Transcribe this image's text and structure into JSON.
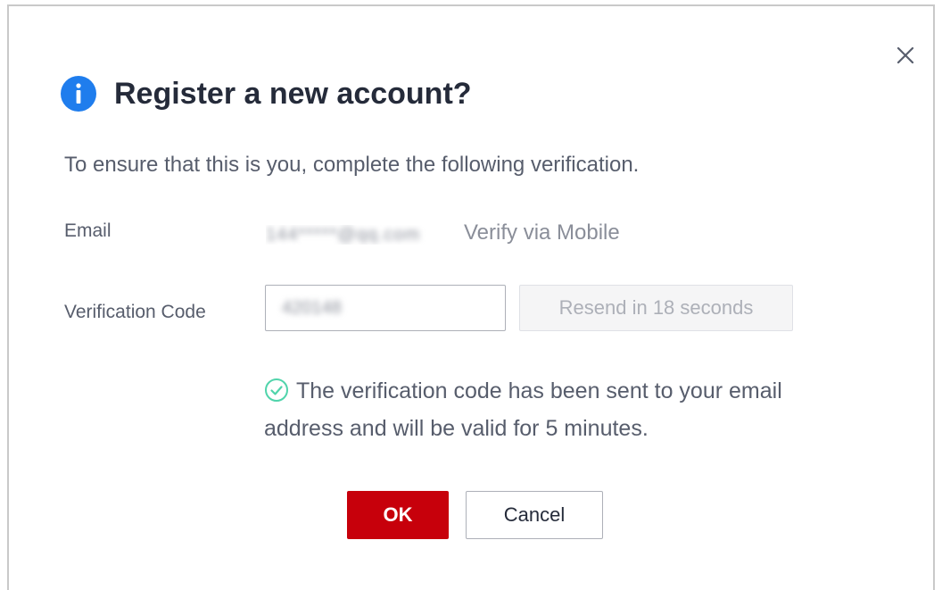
{
  "dialog": {
    "title": "Register a new account?",
    "description": "To ensure that this is you, complete the following verification.",
    "icon": "info-icon",
    "close_icon": "close-icon"
  },
  "email_row": {
    "label": "Email",
    "value": "144*****@qq.com",
    "verify_link": "Verify via Mobile"
  },
  "code_row": {
    "label": "Verification Code",
    "input_value": "420148",
    "resend_label": "Resend in 18 seconds"
  },
  "success": {
    "icon": "check-circle-icon",
    "message": "The verification code has been sent to your email address and will be valid for 5 minutes."
  },
  "buttons": {
    "ok_label": "OK",
    "cancel_label": "Cancel"
  },
  "colors": {
    "primary": "#c7000b",
    "info_blue": "#1f7ded",
    "success_green": "#50d4ab",
    "text": "#575d6c",
    "title": "#252b3a",
    "disabled_text": "#adb0b8"
  }
}
